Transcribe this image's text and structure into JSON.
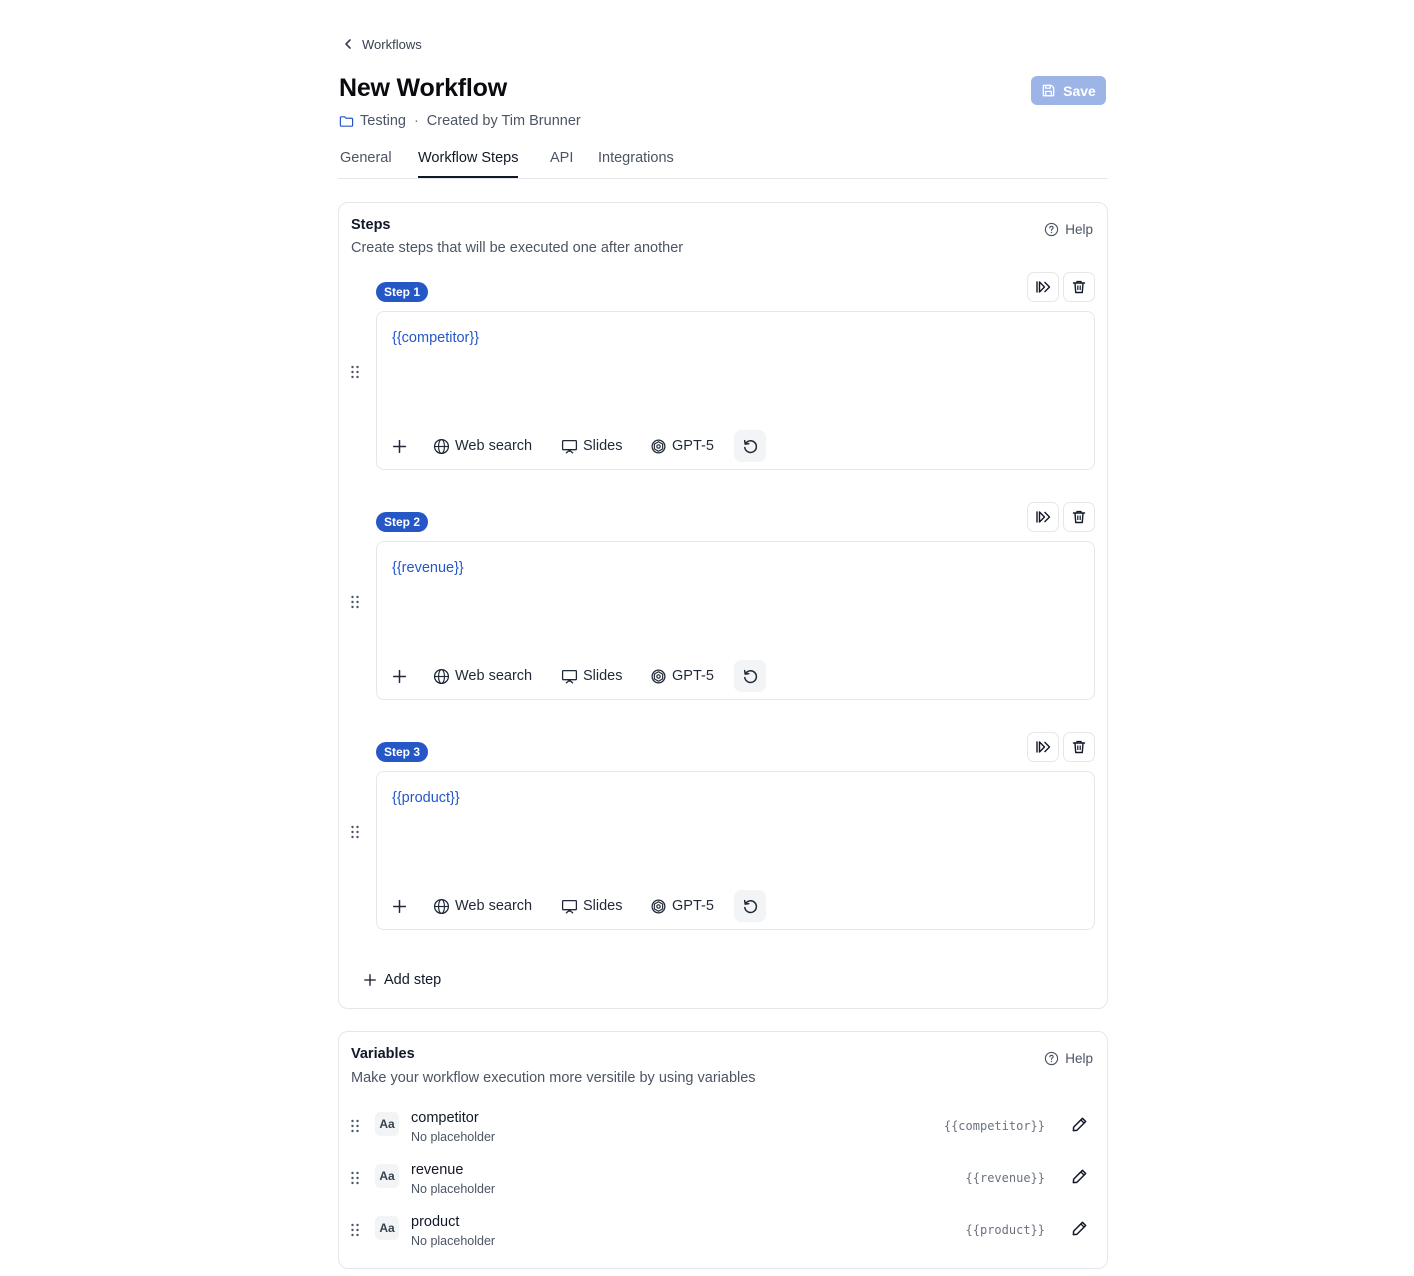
{
  "breadcrumb": {
    "back_label": "Workflows"
  },
  "header": {
    "title": "New Workflow",
    "folder": "Testing",
    "separator": "·",
    "created_by": "Created by Tim Brunner",
    "save_label": "Save"
  },
  "tabs": [
    {
      "label": "General",
      "active": false
    },
    {
      "label": "Workflow Steps",
      "active": true
    },
    {
      "label": "API",
      "active": false
    },
    {
      "label": "Integrations",
      "active": false
    }
  ],
  "steps_card": {
    "title": "Steps",
    "subtitle": "Create steps that will be executed one after another",
    "help_label": "Help",
    "add_step_label": "Add step",
    "steps": [
      {
        "badge": "Step 1",
        "content": "{{competitor}}",
        "tools": {
          "web_search": "Web search",
          "slides": "Slides",
          "model": "GPT-5"
        }
      },
      {
        "badge": "Step 2",
        "content": "{{revenue}}",
        "tools": {
          "web_search": "Web search",
          "slides": "Slides",
          "model": "GPT-5"
        }
      },
      {
        "badge": "Step 3",
        "content": "{{product}}",
        "tools": {
          "web_search": "Web search",
          "slides": "Slides",
          "model": "GPT-5"
        }
      }
    ]
  },
  "variables_card": {
    "title": "Variables",
    "subtitle": "Make your workflow execution more versitile by using variables",
    "help_label": "Help",
    "type_label": "Aa",
    "items": [
      {
        "name": "competitor",
        "placeholder": "No placeholder",
        "token": "{{competitor}}"
      },
      {
        "name": "revenue",
        "placeholder": "No placeholder",
        "token": "{{revenue}}"
      },
      {
        "name": "product",
        "placeholder": "No placeholder",
        "token": "{{product}}"
      }
    ]
  },
  "colors": {
    "accent": "#2557c7",
    "save_button": "#9cb4e6",
    "border": "#e5e7eb"
  }
}
